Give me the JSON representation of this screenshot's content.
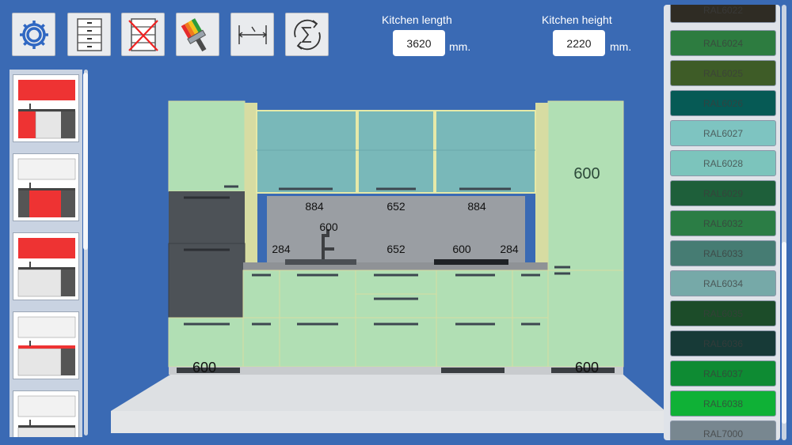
{
  "toolbar": {
    "buttons": [
      {
        "name": "settings-button",
        "icon": "gear-icon"
      },
      {
        "name": "cabinets-button",
        "icon": "drawer-cabinet-icon"
      },
      {
        "name": "delete-cabinet-button",
        "icon": "delete-cabinet-icon"
      },
      {
        "name": "paint-button",
        "icon": "paint-brush-icon"
      },
      {
        "name": "dimensions-button",
        "icon": "dimension-icon"
      },
      {
        "name": "sum-button",
        "icon": "sum-refresh-icon"
      }
    ]
  },
  "kitchen": {
    "length_label": "Kitchen length",
    "length_value": "3620",
    "length_unit": "mm.",
    "height_label": "Kitchen height",
    "height_value": "2220",
    "height_unit": "mm."
  },
  "dimensions": {
    "upper_left": "884",
    "upper_mid": "652",
    "upper_right": "884",
    "tap": "600",
    "side_left": "284",
    "sink": "652",
    "hob": "600",
    "side_right": "284",
    "tall_right": "600",
    "bottom_left": "600",
    "bottom_right": "600"
  },
  "palette": [
    {
      "code": "RAL6022",
      "color": "#2f2c24"
    },
    {
      "code": "RAL6024",
      "color": "#2d7c40"
    },
    {
      "code": "RAL6025",
      "color": "#3e5c27"
    },
    {
      "code": "RAL6026",
      "color": "#065a55"
    },
    {
      "code": "RAL6027",
      "color": "#7ec4c1"
    },
    {
      "code": "RAL6028",
      "color": "#7cc4bc"
    },
    {
      "code": "RAL6029",
      "color": "#1e5f3a"
    },
    {
      "code": "RAL6032",
      "color": "#2b7d45"
    },
    {
      "code": "RAL6033",
      "color": "#467c73"
    },
    {
      "code": "RAL6034",
      "color": "#76a9a8"
    },
    {
      "code": "RAL6035",
      "color": "#1c4c29"
    },
    {
      "code": "RAL6036",
      "color": "#173a37"
    },
    {
      "code": "RAL6037",
      "color": "#0e8b33"
    },
    {
      "code": "RAL6038",
      "color": "#0fb136"
    },
    {
      "code": "RAL7000",
      "color": "#788790"
    }
  ],
  "colors": {
    "background": "#3a6ab4",
    "cabinet_green": "#b1dfb4",
    "upper_teal": "#79b8b9",
    "accent_red": "#ee2222"
  }
}
